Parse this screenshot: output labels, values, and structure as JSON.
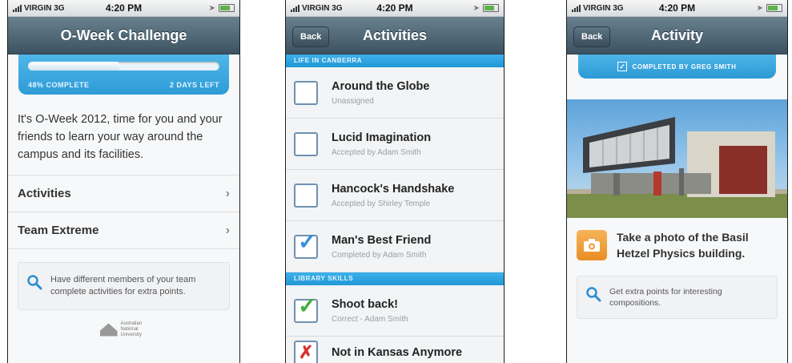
{
  "status": {
    "carrier": "VIRGIN 3G",
    "time": "4:20 PM"
  },
  "screen1": {
    "title": "O-Week Challenge",
    "progress": {
      "fraction": 0.48,
      "complete_label": "48% COMPLETE",
      "remaining_label": "2 DAYS LEFT"
    },
    "intro": "It's O-Week 2012, time for you and your friends to learn your way around the campus and its facilities.",
    "menu": [
      {
        "label": "Activities"
      },
      {
        "label": "Team Extreme"
      }
    ],
    "tip": "Have different members of your team complete activities for extra points.",
    "logo_text": "Australian National University"
  },
  "screen2": {
    "back_label": "Back",
    "title": "Activities",
    "sections": [
      {
        "name": "LIFE IN CANBERRA",
        "items": [
          {
            "title": "Around the Globe",
            "subtitle": "Unassigned",
            "status": "empty"
          },
          {
            "title": "Lucid Imagination",
            "subtitle": "Accepted by Adam Smith",
            "status": "empty"
          },
          {
            "title": "Hancock's Handshake",
            "subtitle": "Accepted by Shirley Temple",
            "status": "empty"
          },
          {
            "title": "Man's Best Friend",
            "subtitle": "Completed by Adam Smith",
            "status": "blue-check"
          }
        ]
      },
      {
        "name": "LIBRARY SKILLS",
        "items": [
          {
            "title": "Shoot back!",
            "subtitle": "Correct - Adam Smith",
            "status": "green-check"
          },
          {
            "title": "Not in Kansas Anymore",
            "subtitle": "",
            "status": "red-cross"
          }
        ]
      }
    ]
  },
  "screen3": {
    "back_label": "Back",
    "title": "Activity",
    "completed_label": "COMPLETED BY GREG SMITH",
    "task": "Take a photo of the Basil Hetzel Physics building.",
    "tip": "Get extra points for interesting compositions."
  },
  "colors": {
    "accent_blue": "#2e9cd7",
    "navbar": "#4a6170",
    "check_green": "#3fae3a",
    "cross_red": "#d9312b",
    "check_blue": "#3a8fd6"
  },
  "icons": [
    "signal-bars-icon",
    "battery-icon",
    "chevron-right-icon",
    "magnifier-icon",
    "checkbox-icon",
    "camera-icon",
    "university-crest-icon"
  ]
}
